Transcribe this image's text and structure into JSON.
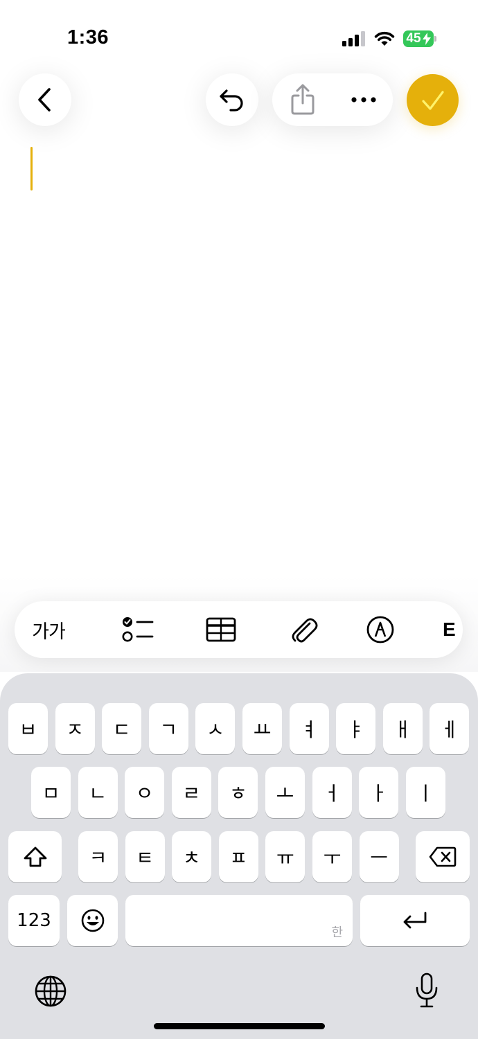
{
  "status_bar": {
    "time": "1:36",
    "battery_level": "45",
    "battery_color": "#34c759",
    "icons": [
      "signal-icon",
      "wifi-icon",
      "battery-icon"
    ]
  },
  "nav": {
    "icons": [
      "chevron-left-icon",
      "undo-icon",
      "share-icon",
      "ellipsis-icon",
      "checkmark-icon"
    ],
    "accent_color": "#e5b00b"
  },
  "editor": {
    "text": ""
  },
  "toolbar": {
    "text_format_label": "가가",
    "more_label": "E",
    "icons": [
      "checklist-icon",
      "table-icon",
      "paperclip-icon",
      "markup-icon"
    ]
  },
  "keyboard": {
    "row1": [
      "ㅂ",
      "ㅈ",
      "ㄷ",
      "ㄱ",
      "ㅅ",
      "ㅛ",
      "ㅕ",
      "ㅑ",
      "ㅐ",
      "ㅔ"
    ],
    "row2": [
      "ㅁ",
      "ㄴ",
      "ㅇ",
      "ㄹ",
      "ㅎ",
      "ㅗ",
      "ㅓ",
      "ㅏ",
      "ㅣ"
    ],
    "row3": [
      "ㅋ",
      "ㅌ",
      "ㅊ",
      "ㅍ",
      "ㅠ",
      "ㅜ",
      "ㅡ"
    ],
    "numbers_label": "123",
    "space_hint": "한",
    "icons": [
      "shift-icon",
      "delete-icon",
      "emoji-icon",
      "return-icon",
      "globe-icon",
      "microphone-icon"
    ]
  }
}
